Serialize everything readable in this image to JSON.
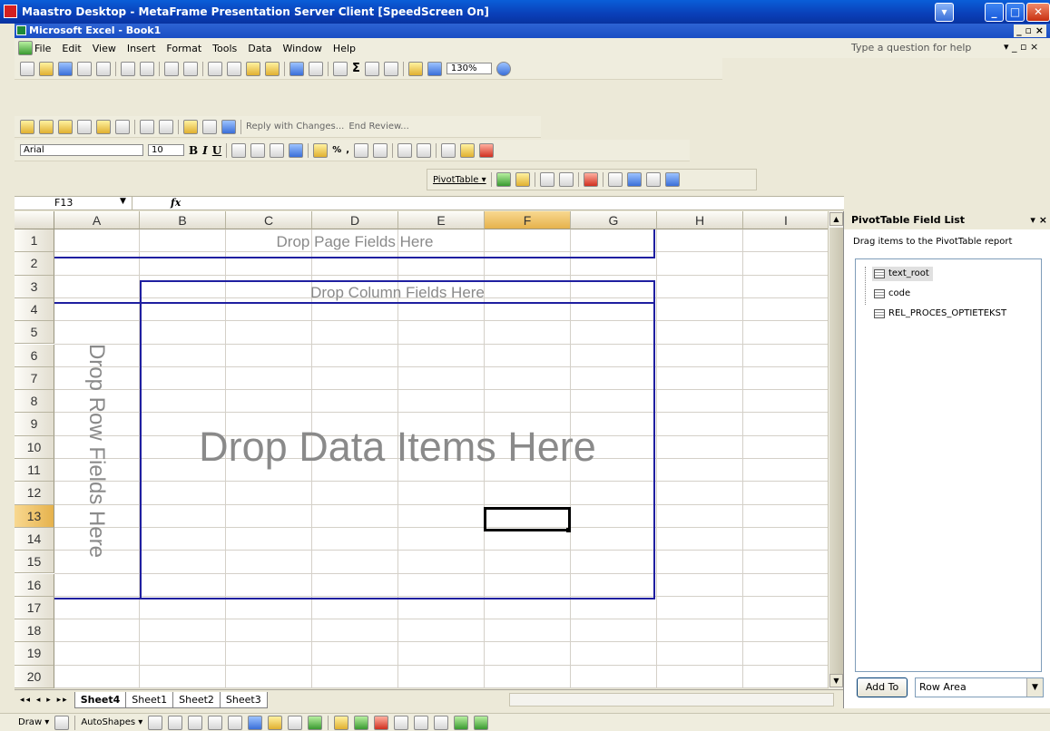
{
  "window": {
    "title": "Maastro Desktop - MetaFrame Presentation Server Client [SpeedScreen On]",
    "excel_title": "Microsoft Excel - Book1"
  },
  "menu": {
    "items": [
      "File",
      "Edit",
      "View",
      "Insert",
      "Format",
      "Tools",
      "Data",
      "Window",
      "Help"
    ],
    "help_placeholder": "Type a question for help"
  },
  "toolbar": {
    "zoom": "130%",
    "reply_label": "Reply with Changes...",
    "end_review_label": "End Review...",
    "font_name": "Arial",
    "font_size": "10",
    "bold": "B",
    "italic": "I",
    "underline": "U",
    "percent": "%",
    "comma": ",",
    "pivottable_label": "PivotTable ▾"
  },
  "formula_bar": {
    "cell_ref": "F13",
    "fx": "fx",
    "value": ""
  },
  "sheet": {
    "columns": [
      "A",
      "B",
      "C",
      "D",
      "E",
      "F",
      "G",
      "H",
      "I"
    ],
    "rows": [
      "1",
      "2",
      "3",
      "4",
      "5",
      "6",
      "7",
      "8",
      "9",
      "10",
      "11",
      "12",
      "13",
      "14",
      "15",
      "16",
      "17",
      "18",
      "19",
      "20"
    ],
    "active_cell": "F13",
    "drop_page": "Drop Page Fields Here",
    "drop_column": "Drop Column Fields Here",
    "drop_row": "Drop Row Fields Here",
    "drop_data": "Drop Data Items Here"
  },
  "tabs": {
    "items": [
      "Sheet4",
      "Sheet1",
      "Sheet2",
      "Sheet3"
    ],
    "active": "Sheet4"
  },
  "drawbar": {
    "draw_label": "Draw ▾",
    "autoshapes_label": "AutoShapes ▾"
  },
  "pivot_panel": {
    "title": "PivotTable Field List",
    "subtitle": "Drag items to the PivotTable report",
    "fields": [
      "text_root",
      "code",
      "REL_PROCES_OPTIETEKST"
    ],
    "add_to_label": "Add To",
    "area_value": "Row Area"
  },
  "colors": {
    "titlebar": "#0a4fc8",
    "drop_border": "#1f1fa0",
    "drop_text": "#8a8a8a"
  }
}
